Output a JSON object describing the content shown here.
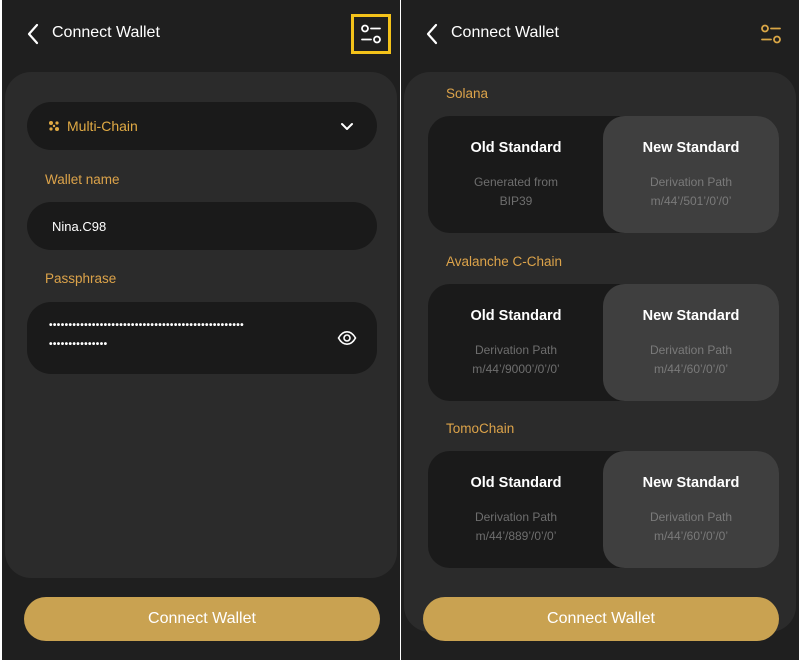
{
  "left": {
    "header": {
      "title": "Connect Wallet"
    },
    "chain_select": {
      "label": "Multi-Chain"
    },
    "wallet_name": {
      "label": "Wallet name",
      "value": "Nina.C98"
    },
    "passphrase": {
      "label": "Passphrase",
      "line1": "••••••••••••••••••••••••••••••••••••••••••••••••••",
      "line2": "•••••••••••••••"
    },
    "connect_button": "Connect Wallet"
  },
  "right": {
    "header": {
      "title": "Connect Wallet"
    },
    "sections": [
      {
        "title": "Solana",
        "old": {
          "name": "Old Standard",
          "line1": "Generated from",
          "line2": "BIP39"
        },
        "new": {
          "name": "New Standard",
          "line1": "Derivation Path",
          "line2": "m/44’/501’/0’/0’"
        }
      },
      {
        "title": "Avalanche C-Chain",
        "old": {
          "name": "Old Standard",
          "line1": "Derivation Path",
          "line2": "m/44’/9000’/0’/0’"
        },
        "new": {
          "name": "New Standard",
          "line1": "Derivation Path",
          "line2": "m/44’/60’/0’/0’"
        }
      },
      {
        "title": "TomoChain",
        "old": {
          "name": "Old Standard",
          "line1": "Derivation Path",
          "line2": "m/44’/889’/0’/0’"
        },
        "new": {
          "name": "New Standard",
          "line1": "Derivation Path",
          "line2": "m/44’/60’/0’/0’"
        }
      }
    ],
    "connect_button": "Connect Wallet"
  },
  "colors": {
    "background": "#1f1f1f",
    "card": "#2b2b2b",
    "accent": "#c9a251",
    "label_gold": "#dca34a",
    "highlight": "#f3c21a"
  },
  "icons": [
    "back-arrow-icon",
    "filter-settings-icon",
    "multi-chain-icon",
    "chevron-down-icon",
    "eye-icon"
  ]
}
